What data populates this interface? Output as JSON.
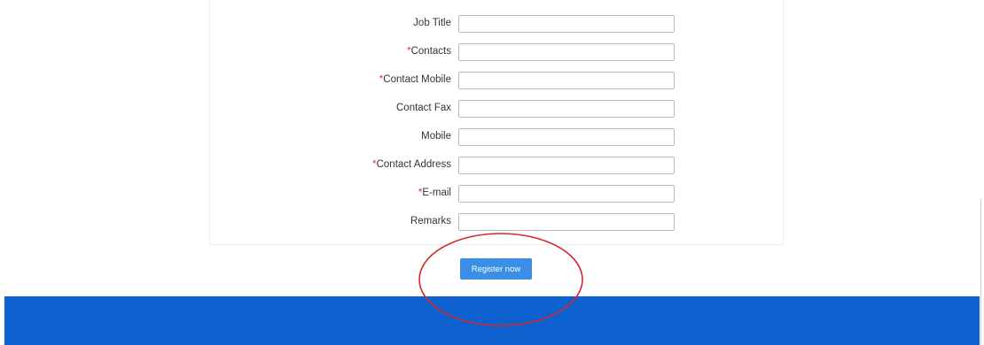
{
  "form": {
    "fields": [
      {
        "label": "Job Title",
        "required": false,
        "value": ""
      },
      {
        "label": "Contacts",
        "required": true,
        "value": ""
      },
      {
        "label": "Contact Mobile",
        "required": true,
        "value": ""
      },
      {
        "label": "Contact Fax",
        "required": false,
        "value": ""
      },
      {
        "label": "Mobile",
        "required": false,
        "value": ""
      },
      {
        "label": "Contact Address",
        "required": true,
        "value": ""
      },
      {
        "label": "E-mail",
        "required": true,
        "value": ""
      },
      {
        "label": "Remarks",
        "required": false,
        "value": ""
      }
    ],
    "required_marker": "*"
  },
  "actions": {
    "register_label": "Register now"
  },
  "colors": {
    "accent_button": "#3a8ee6",
    "footer_band": "#0d62cf",
    "required_marker": "#e0362f",
    "annotation_circle": "#d9262c"
  }
}
